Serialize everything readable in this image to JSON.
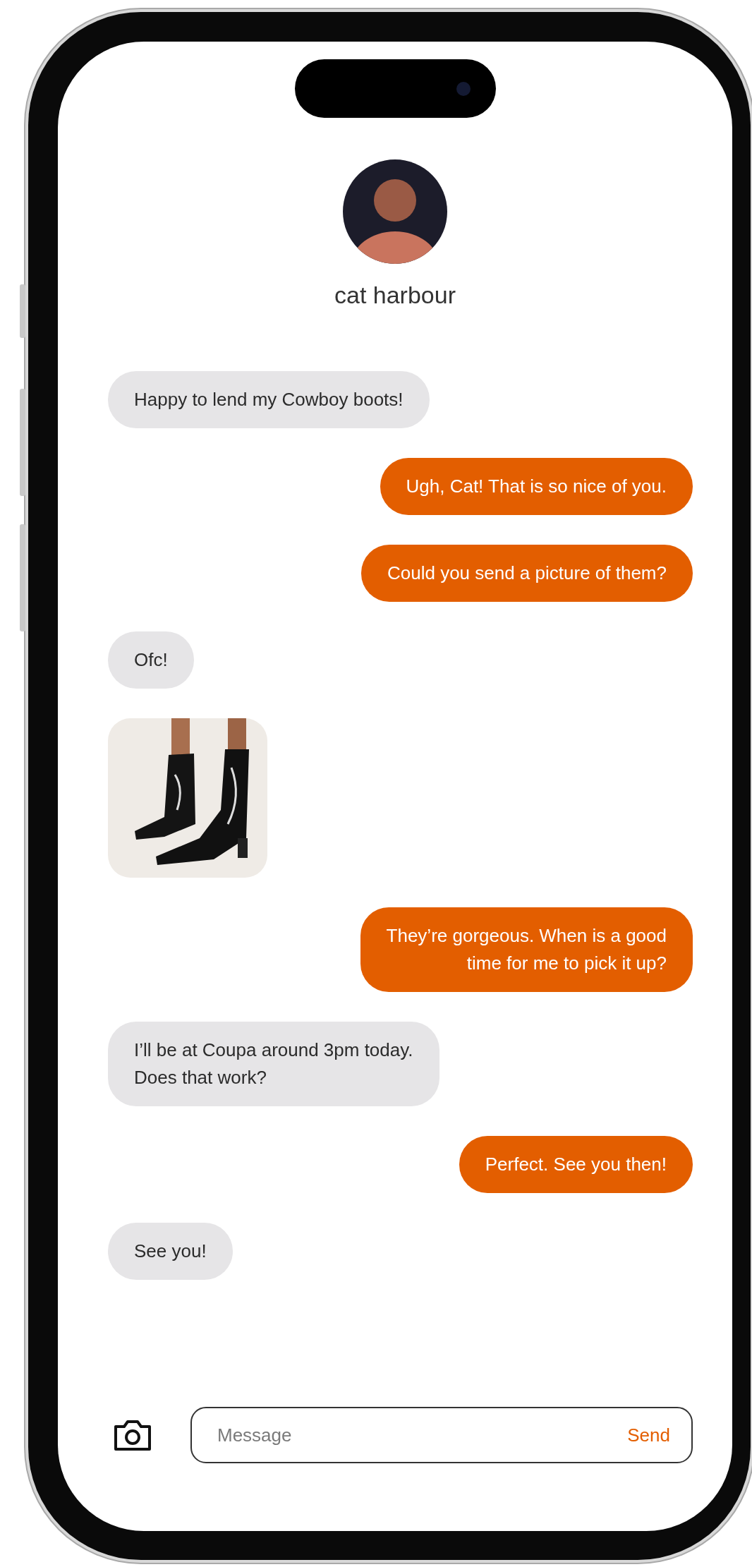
{
  "contact": {
    "name": "cat harbour"
  },
  "messages": [
    {
      "kind": "text",
      "outgoing": false,
      "text": "Happy to lend my Cowboy boots!"
    },
    {
      "kind": "text",
      "outgoing": true,
      "text": "Ugh, Cat! That is so nice of you."
    },
    {
      "kind": "text",
      "outgoing": true,
      "text": "Could you send a picture of them?"
    },
    {
      "kind": "text",
      "outgoing": false,
      "text": "Ofc!"
    },
    {
      "kind": "picture",
      "outgoing": false
    },
    {
      "kind": "text",
      "outgoing": true,
      "text": "They’re gorgeous. When is a good\ntime for me to pick it up?"
    },
    {
      "kind": "text",
      "outgoing": false,
      "text": "I’ll be at Coupa around 3pm today.\nDoes that work?"
    },
    {
      "kind": "text",
      "outgoing": true,
      "text": "Perfect. See you then!"
    },
    {
      "kind": "text",
      "outgoing": false,
      "text": "See you!"
    }
  ],
  "composer": {
    "placeholder": "Message",
    "send": "Send"
  }
}
